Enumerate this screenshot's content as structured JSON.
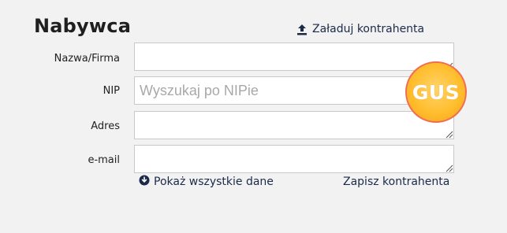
{
  "section": {
    "title": "Nabywca",
    "load_contractor_label": "Załaduj kontrahenta"
  },
  "fields": {
    "name": {
      "label": "Nazwa/Firma",
      "value": "",
      "placeholder": ""
    },
    "nip": {
      "label": "NIP",
      "value": "",
      "placeholder": "Wyszukaj po NIPie"
    },
    "address": {
      "label": "Adres",
      "value": "",
      "placeholder": ""
    },
    "email": {
      "label": "e-mail",
      "value": "",
      "placeholder": ""
    }
  },
  "gus_button": {
    "label": "GUS"
  },
  "footer": {
    "show_all_label": "Pokaż wszystkie dane",
    "save_contractor_label": "Zapisz kontrahenta"
  },
  "icons": {
    "upload": "upload-icon",
    "download": "download-circle-icon",
    "resize": "resize-grip-icon"
  },
  "colors": {
    "background": "#f2f2f2",
    "link": "#1b2a4a",
    "gus_fill": "#ffbe2e",
    "gus_border": "#f26d4f"
  }
}
